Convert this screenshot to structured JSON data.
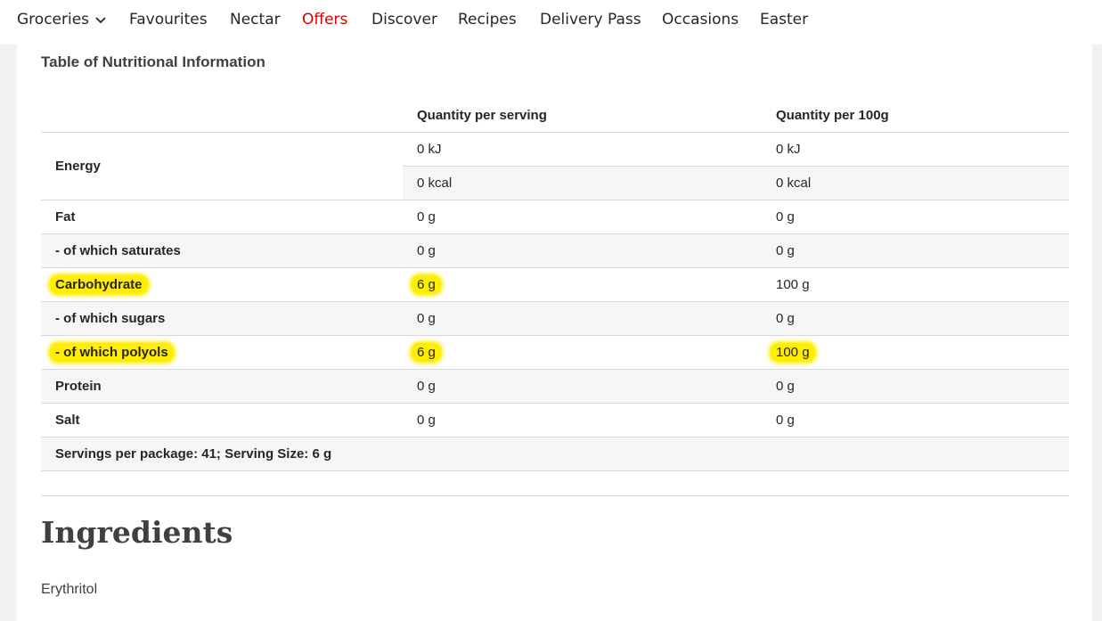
{
  "nav": {
    "items": [
      {
        "label": "Groceries",
        "has_dropdown": true,
        "active": false
      },
      {
        "label": "Favourites",
        "active": false
      },
      {
        "label": "Nectar",
        "active": false
      },
      {
        "label": "Offers",
        "active": true
      },
      {
        "label": "Discover",
        "active": false
      },
      {
        "label": "Recipes",
        "active": false
      },
      {
        "label": "Delivery Pass",
        "active": false
      },
      {
        "label": "Occasions",
        "active": false
      },
      {
        "label": "Easter",
        "active": false
      }
    ],
    "active_color": "#d50000"
  },
  "nutrition": {
    "title": "Table of Nutritional Information",
    "headers": {
      "blank": "",
      "per_serving": "Quantity per serving",
      "per_100g": "Quantity per 100g"
    },
    "energy": {
      "label": "Energy",
      "kj_serving": "0 kJ",
      "kj_100g": "0 kJ",
      "kcal_serving": "0 kcal",
      "kcal_100g": "0 kcal"
    },
    "rows": [
      {
        "label": "Fat",
        "serving": "0 g",
        "per100": "0 g"
      },
      {
        "label": "- of which saturates",
        "serving": "0 g",
        "per100": "0 g"
      },
      {
        "label": "Carbohydrate",
        "serving": "6 g",
        "per100": "100 g"
      },
      {
        "label": "- of which sugars",
        "serving": "0 g",
        "per100": "0 g"
      },
      {
        "label": "- of which polyols",
        "serving": "6 g",
        "per100": "100 g"
      },
      {
        "label": "Protein",
        "serving": "0 g",
        "per100": "0 g"
      },
      {
        "label": "Salt",
        "serving": "0 g",
        "per100": "0 g"
      }
    ],
    "footer": "Servings per package: 41; Serving Size: 6 g",
    "highlight_color": "#ffee00"
  },
  "ingredients": {
    "heading": "Ingredients",
    "text": "Erythritol"
  }
}
